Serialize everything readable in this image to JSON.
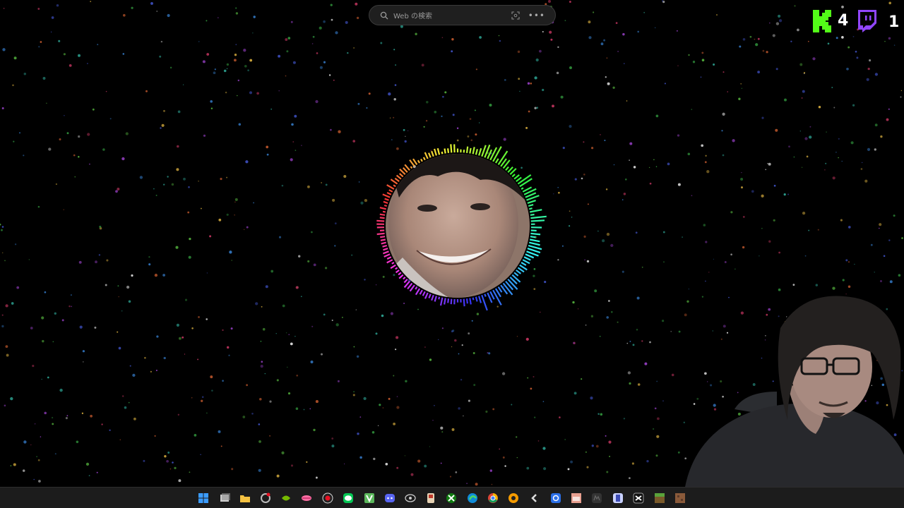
{
  "search": {
    "placeholder": "Web の検索",
    "icon": "search-icon",
    "visual_search_icon": "visual-search-icon",
    "more_icon": "more-icon"
  },
  "stream_overlay": {
    "kick_count": "4",
    "twitch_count": "1",
    "kick_color": "#53fc18",
    "twitch_color": "#9146ff"
  },
  "taskbar": {
    "items": [
      {
        "name": "start-button",
        "label": ""
      },
      {
        "name": "task-view",
        "label": ""
      },
      {
        "name": "file-explorer",
        "label": ""
      },
      {
        "name": "app-1",
        "label": ""
      },
      {
        "name": "nvidia",
        "label": ""
      },
      {
        "name": "app-lips",
        "label": ""
      },
      {
        "name": "obs",
        "label": ""
      },
      {
        "name": "line",
        "label": "LINE"
      },
      {
        "name": "app-v",
        "label": "V"
      },
      {
        "name": "discord",
        "label": ""
      },
      {
        "name": "app-11",
        "label": ""
      },
      {
        "name": "app-12",
        "label": ""
      },
      {
        "name": "xbox",
        "label": ""
      },
      {
        "name": "edge",
        "label": ""
      },
      {
        "name": "chrome",
        "label": ""
      },
      {
        "name": "app-16",
        "label": ""
      },
      {
        "name": "app-17",
        "label": ""
      },
      {
        "name": "app-18",
        "label": ""
      },
      {
        "name": "app-19",
        "label": ""
      },
      {
        "name": "app-20",
        "label": ""
      },
      {
        "name": "app-21",
        "label": ""
      },
      {
        "name": "capcut",
        "label": ""
      },
      {
        "name": "minecraft",
        "label": ""
      },
      {
        "name": "app-24",
        "label": ""
      }
    ]
  }
}
